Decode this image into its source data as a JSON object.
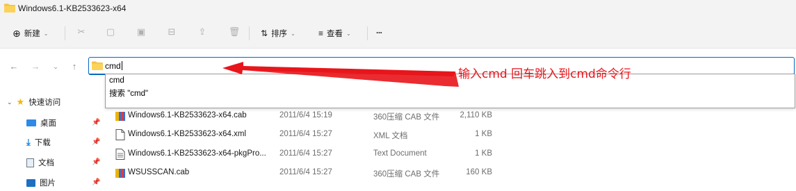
{
  "window": {
    "title": "Windows6.1-KB2533623-x64"
  },
  "toolbar": {
    "new_label": "新建",
    "sort_label": "排序",
    "view_label": "查看",
    "more_label": "···"
  },
  "address": {
    "value": "cmd"
  },
  "suggestions": [
    {
      "label": "cmd"
    },
    {
      "label": "搜索 \"cmd\""
    }
  ],
  "sidebar": {
    "quick_access": "快速访问",
    "items": [
      {
        "label": "桌面",
        "icon": "desktop-icon"
      },
      {
        "label": "下载",
        "icon": "download-icon"
      },
      {
        "label": "文档",
        "icon": "document-icon"
      },
      {
        "label": "图片",
        "icon": "picture-icon"
      }
    ]
  },
  "files": [
    {
      "name": "Windows6.1-KB2533623-x64.cab",
      "date": "2011/6/4 15:19",
      "type": "360压缩 CAB 文件",
      "size": "2,110 KB",
      "icon": "cab-archive-icon"
    },
    {
      "name": "Windows6.1-KB2533623-x64.xml",
      "date": "2011/6/4 15:27",
      "type": "XML 文档",
      "size": "1 KB",
      "icon": "xml-file-icon"
    },
    {
      "name": "Windows6.1-KB2533623-x64-pkgPro...",
      "date": "2011/6/4 15:27",
      "type": "Text Document",
      "size": "1 KB",
      "icon": "text-file-icon"
    },
    {
      "name": "WSUSSCAN.cab",
      "date": "2011/6/4 15:27",
      "type": "360压缩 CAB 文件",
      "size": "160 KB",
      "icon": "cab-archive-icon"
    }
  ],
  "annotation": {
    "text": "输入cmd  回车跳入到cmd命令行"
  },
  "colors": {
    "accent": "#0067c0",
    "annotation": "#e8151b",
    "folder": "#f5c242"
  }
}
